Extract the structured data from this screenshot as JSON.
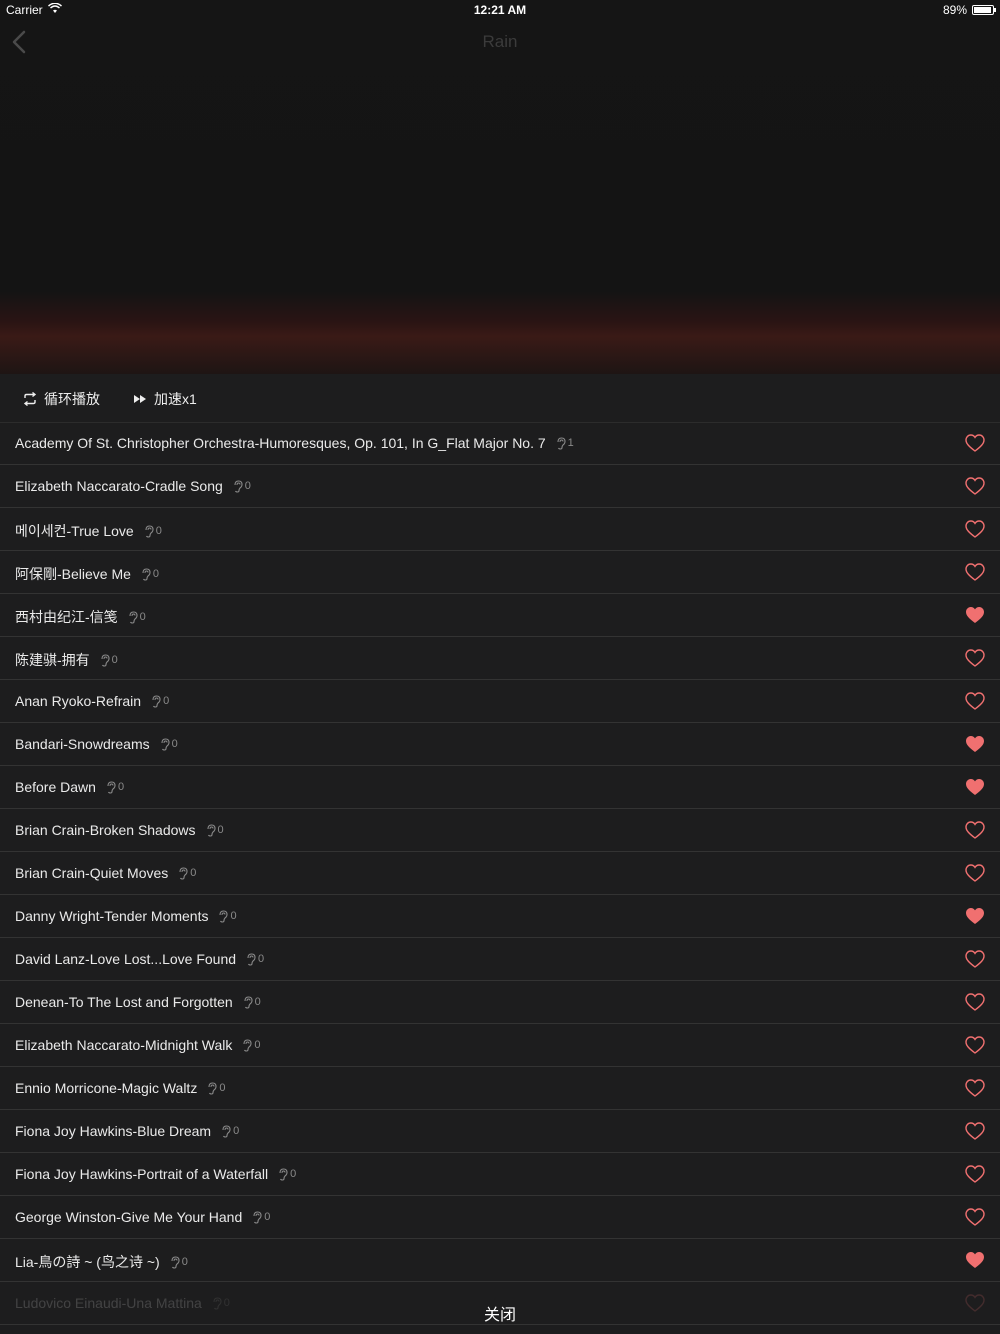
{
  "status": {
    "carrier": "Carrier",
    "time": "12:21 AM",
    "battery": "89%"
  },
  "nav": {
    "title": "Rain"
  },
  "controls": {
    "loop_label": "循环播放",
    "speed_label": "加速x1"
  },
  "colors": {
    "accent": "#f07070",
    "background": "#1d1d1e"
  },
  "tracks": [
    {
      "title": "Academy Of St. Christopher Orchestra-Humoresques, Op. 101, In G_Flat Major No. 7",
      "plays": "1",
      "favorite": false
    },
    {
      "title": "Elizabeth Naccarato-Cradle Song",
      "plays": "0",
      "favorite": false
    },
    {
      "title": "메이세컨-True Love",
      "plays": "0",
      "favorite": false
    },
    {
      "title": "阿保剛-Believe Me",
      "plays": "0",
      "favorite": false
    },
    {
      "title": "西村由纪江-信笺",
      "plays": "0",
      "favorite": true
    },
    {
      "title": "陈建骐-拥有",
      "plays": "0",
      "favorite": false
    },
    {
      "title": "Anan Ryoko-Refrain",
      "plays": "0",
      "favorite": false
    },
    {
      "title": "Bandari-Snowdreams",
      "plays": "0",
      "favorite": true
    },
    {
      "title": "Before Dawn",
      "plays": "0",
      "favorite": true
    },
    {
      "title": "Brian Crain-Broken Shadows",
      "plays": "0",
      "favorite": false
    },
    {
      "title": "Brian Crain-Quiet Moves",
      "plays": "0",
      "favorite": false
    },
    {
      "title": "Danny Wright-Tender Moments",
      "plays": "0",
      "favorite": true
    },
    {
      "title": "David Lanz-Love Lost...Love Found",
      "plays": "0",
      "favorite": false
    },
    {
      "title": "Denean-To The Lost and Forgotten",
      "plays": "0",
      "favorite": false
    },
    {
      "title": "Elizabeth Naccarato-Midnight Walk",
      "plays": "0",
      "favorite": false
    },
    {
      "title": "Ennio Morricone-Magic Waltz",
      "plays": "0",
      "favorite": false
    },
    {
      "title": "Fiona Joy Hawkins-Blue Dream",
      "plays": "0",
      "favorite": false
    },
    {
      "title": "Fiona Joy Hawkins-Portrait of a Waterfall",
      "plays": "0",
      "favorite": false
    },
    {
      "title": "George Winston-Give Me Your Hand",
      "plays": "0",
      "favorite": false
    },
    {
      "title": "Lia-鳥の詩 ~ (鸟之诗 ~)",
      "plays": "0",
      "favorite": true
    },
    {
      "title": "Ludovico Einaudi-Una Mattina",
      "plays": "0",
      "favorite": false
    }
  ],
  "close_label": "关闭"
}
